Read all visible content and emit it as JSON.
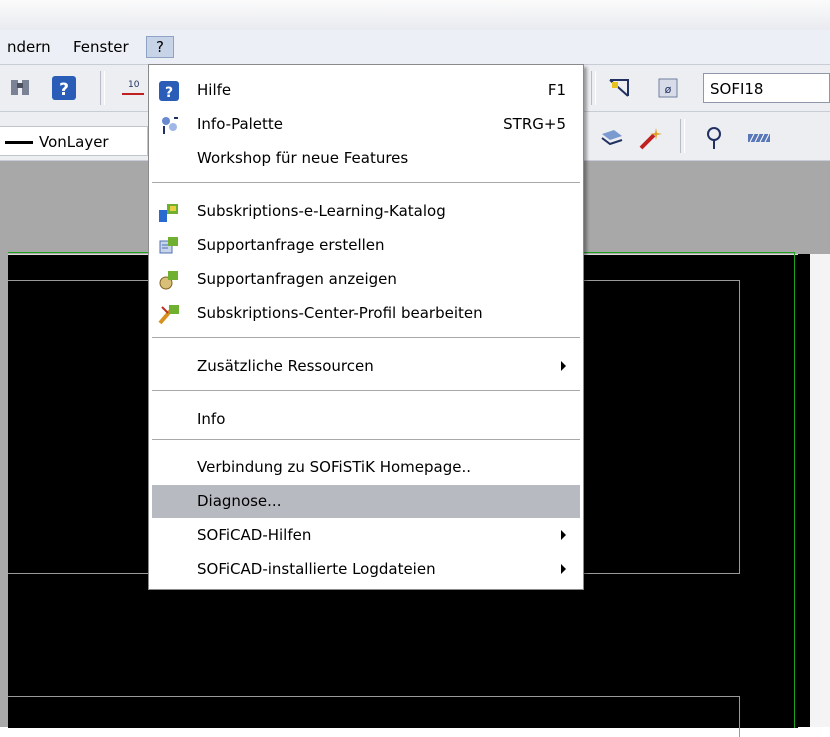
{
  "menubar": {
    "items": [
      {
        "label": "ndern"
      },
      {
        "label": "Fenster"
      },
      {
        "label": "?"
      }
    ]
  },
  "toolbar": {
    "layer_linetype": "VonLayer",
    "style_field": "SOFI18"
  },
  "help_menu": {
    "items": [
      {
        "label": "Hilfe",
        "shortcut": "F1",
        "icon": "help-icon"
      },
      {
        "label": "Info-Palette",
        "shortcut": "STRG+5",
        "icon": "info-palette-icon"
      },
      {
        "label": "Workshop für neue Features"
      },
      {
        "label": "Subskriptions-e-Learning-Katalog",
        "icon": "elearning-icon"
      },
      {
        "label": "Supportanfrage erstellen",
        "icon": "support-request-icon"
      },
      {
        "label": "Supportanfragen anzeigen",
        "icon": "support-view-icon"
      },
      {
        "label": "Subskriptions-Center-Profil bearbeiten",
        "icon": "profile-edit-icon"
      },
      {
        "label": "Zusätzliche Ressourcen",
        "submenu": true
      },
      {
        "label": "Info"
      },
      {
        "label": "Verbindung zu SOFiSTiK Homepage.."
      },
      {
        "label": "Diagnose...",
        "highlighted": true
      },
      {
        "label": "SOFiCAD-Hilfen",
        "submenu": true
      },
      {
        "label": "SOFiCAD-installierte Logdateien",
        "submenu": true
      }
    ]
  },
  "colors": {
    "canvas": "#000000",
    "frame_green": "#1ca51c",
    "highlight": "#b8bac2",
    "menubar": "#eceff5"
  }
}
